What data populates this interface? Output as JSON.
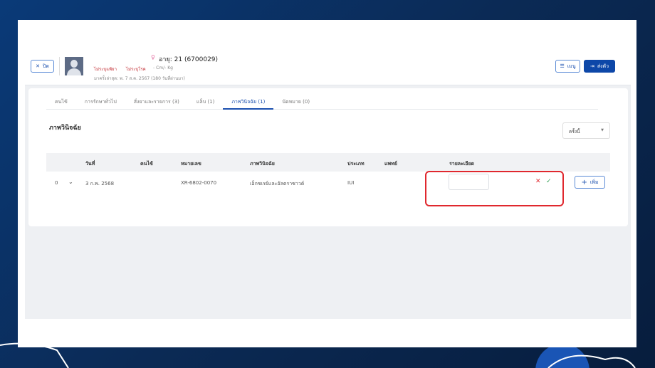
{
  "header": {
    "close_label": "ปิด",
    "age": "อายุ: 21 (6700029)",
    "allergy": "ไม่ระบุแพ้ยา",
    "disease": "ไม่ระบุโรค",
    "body": "- Cm/- Kg",
    "last_visit": "มาครั้งล่าสุด: พ. 7 ส.ค. 2567 (180 วันที่ผ่านมา)",
    "menu_label": "เมนู",
    "refer_label": "ส่งตัว"
  },
  "tabs": [
    {
      "label": "คนไข้"
    },
    {
      "label": "การรักษาทั่วไป"
    },
    {
      "label": "สั่งยาและรายการ (3)"
    },
    {
      "label": "แล็บ (1)"
    },
    {
      "label": "ภาพวินิจฉัย (1)"
    },
    {
      "label": "นัดหมาย (0)"
    }
  ],
  "section": {
    "title": "ภาพวินิจฉัย",
    "filter": "ครั้งนี้"
  },
  "table": {
    "headers": [
      "วันที่",
      "คนไข้",
      "หมายเลข",
      "ภาพวินิจฉัย",
      "ประเภท",
      "แพทย์",
      "รายละเอียด"
    ],
    "row": {
      "index": "0",
      "date": "3 ก.พ. 2568",
      "number": "XR-6802-0070",
      "imaging": "เอ็กซเรย์และอัลตราซาวด์",
      "type": "IUI",
      "detail": ""
    }
  },
  "add_label": "เพิ่ม",
  "colors": {
    "primary": "#1a4fae",
    "highlight": "#e0282e"
  }
}
